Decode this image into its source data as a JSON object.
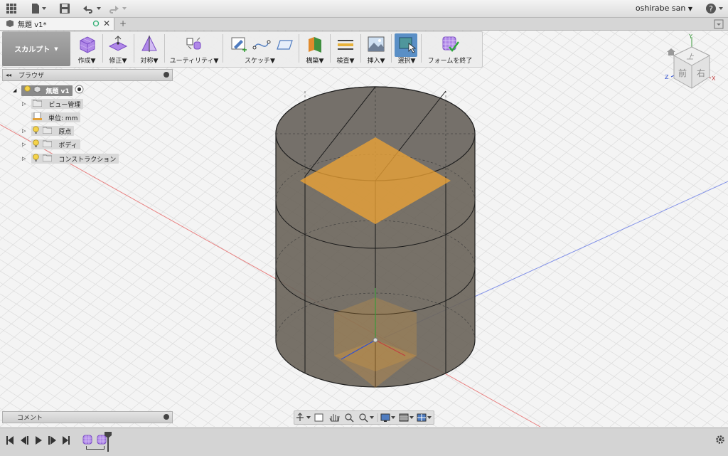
{
  "app": {
    "user_name": "oshirabe san",
    "help_label": "?"
  },
  "document": {
    "tab_title": "無題 v1*"
  },
  "toolbar": {
    "workspace": "スカルプト",
    "groups": {
      "create": "作成",
      "modify": "修正",
      "symmetry": "対称",
      "utility": "ユーティリティ",
      "sketch": "スケッチ",
      "construct": "構築",
      "inspect": "検査",
      "insert": "挿入",
      "select": "選択",
      "finish": "フォームを終了"
    }
  },
  "browser": {
    "title": "ブラウザ",
    "root": "無題 v1",
    "items": {
      "view_mgmt": "ビュー管理",
      "units": "単位: mm",
      "origin": "原点",
      "bodies": "ボディ",
      "construction": "コンストラクション"
    }
  },
  "comments": {
    "title": "コメント"
  },
  "viewcube": {
    "top": "上",
    "front": "前",
    "right": "右",
    "axis_y": "Y",
    "axis_z": "Z",
    "axis_x": "X"
  },
  "colors": {
    "accent_select": "#5a8fc6",
    "tsplines_purple": "#9b6ad8",
    "body_fill": "#6e675c",
    "plane_orange": "#f2a534"
  }
}
